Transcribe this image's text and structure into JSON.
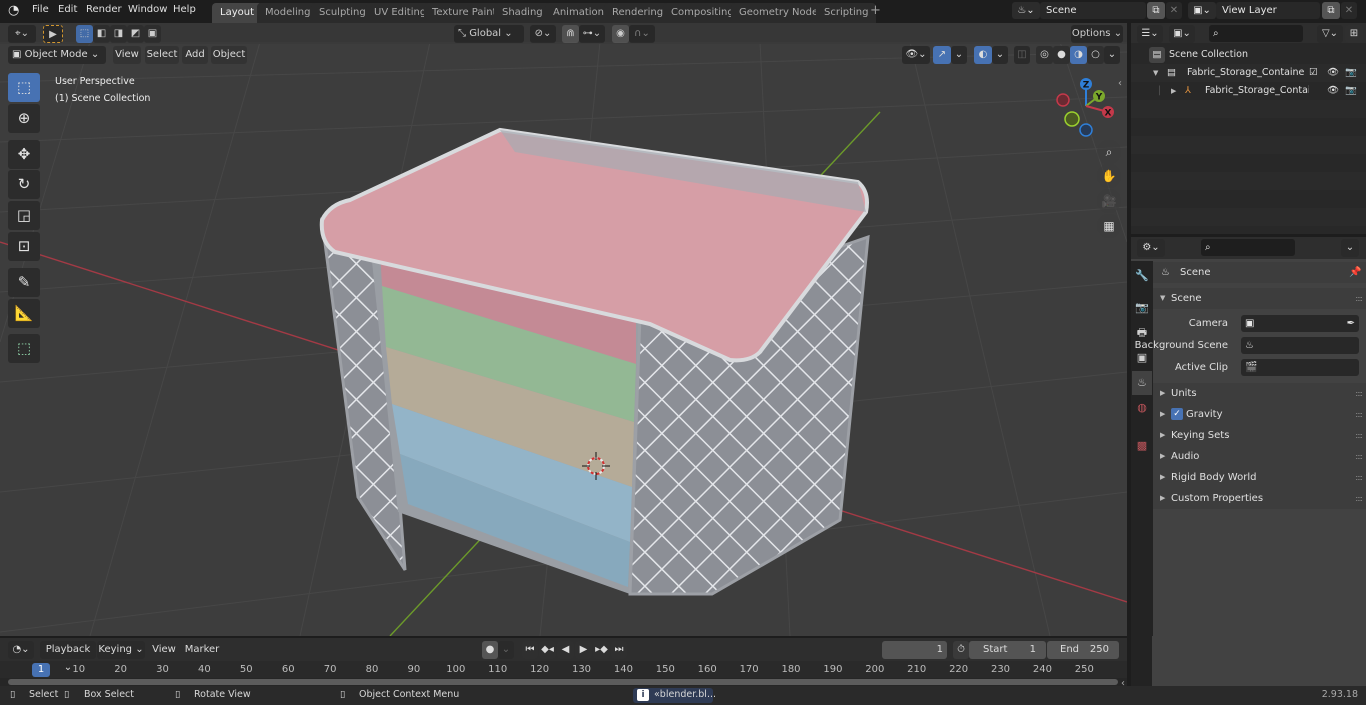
{
  "topbar": {
    "menus": [
      "File",
      "Edit",
      "Render",
      "Window",
      "Help"
    ],
    "workspaces": [
      "Layout",
      "Modeling",
      "Sculpting",
      "UV Editing",
      "Texture Paint",
      "Shading",
      "Animation",
      "Rendering",
      "Compositing",
      "Geometry Nodes",
      "Scripting"
    ],
    "active_workspace": "Layout",
    "add_workspace": "+",
    "scene_name": "Scene",
    "view_layer_name": "View Layer"
  },
  "viewport": {
    "mode": "Object Mode",
    "menus": [
      "View",
      "Select",
      "Add",
      "Object"
    ],
    "transform_orientation": "Global",
    "options_label": "Options",
    "overlay_title": "User Perspective",
    "overlay_subtitle": "(1) Scene Collection",
    "gizmo_axes": {
      "x": "X",
      "y": "Y",
      "z": "Z"
    },
    "tools": [
      "select-box",
      "cursor",
      "move",
      "rotate",
      "scale",
      "transform",
      "annotate",
      "measure",
      "add-cube"
    ],
    "nav_buttons": [
      "zoom",
      "pan",
      "camera",
      "ortho-toggle"
    ],
    "colors": {
      "x_axis": "#c4394a",
      "y_axis": "#7ba82c",
      "z_axis": "#2f7fd8",
      "accent": "#4772b3"
    }
  },
  "outliner": {
    "search_placeholder": "",
    "root": "Scene Collection",
    "items": [
      {
        "name": "Fabric_Storage_Container_Gn",
        "type": "collection",
        "checked": true
      },
      {
        "name": "Fabric_Storage_Containe",
        "type": "empty"
      }
    ]
  },
  "properties": {
    "search_placeholder": "",
    "context_label": "Scene",
    "section_title": "Scene",
    "fields": [
      {
        "label": "Camera",
        "value": ""
      },
      {
        "label": "Background Scene",
        "value": ""
      },
      {
        "label": "Active Clip",
        "value": ""
      }
    ],
    "panels": [
      {
        "label": "Units"
      },
      {
        "label": "Gravity",
        "checkbox": true
      },
      {
        "label": "Keying Sets"
      },
      {
        "label": "Audio"
      },
      {
        "label": "Rigid Body World"
      },
      {
        "label": "Custom Properties"
      }
    ]
  },
  "timeline": {
    "menus": [
      "Playback",
      "Keying",
      "View",
      "Marker"
    ],
    "current_frame": "1",
    "start_label": "Start",
    "start_value": "1",
    "end_label": "End",
    "end_value": "250",
    "playhead_label": "1",
    "ticks": [
      "10",
      "20",
      "30",
      "40",
      "50",
      "60",
      "70",
      "80",
      "90",
      "100",
      "110",
      "120",
      "130",
      "140",
      "150",
      "160",
      "170",
      "180",
      "190",
      "200",
      "210",
      "220",
      "230",
      "240",
      "250"
    ]
  },
  "statusbar": {
    "hints": [
      "Select",
      "Box Select",
      "Rotate View",
      "Object Context Menu"
    ],
    "report": "«blender.bl...",
    "version": "2.93.18"
  }
}
